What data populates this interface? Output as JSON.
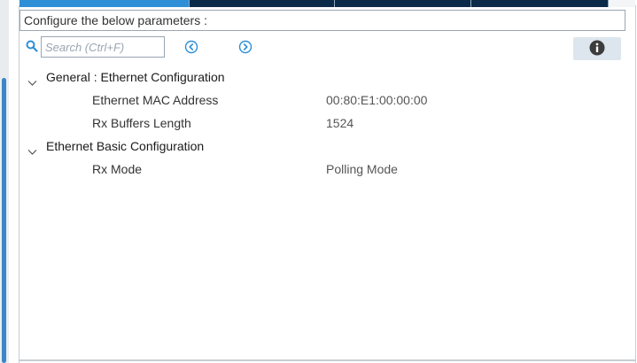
{
  "header": {
    "title": "Configure the below parameters :"
  },
  "search": {
    "placeholder": "Search (Ctrl+F)"
  },
  "icons": {
    "search": "search-icon",
    "prev": "circle-chevron-left-icon",
    "next": "circle-chevron-right-icon",
    "info": "info-icon",
    "expand": "chevron-down-icon"
  },
  "colors": {
    "accent": "#2e8fd6",
    "tab_bar": "#0b2a4a",
    "info_button_bg": "#dde6ee"
  },
  "tree": {
    "groups": [
      {
        "label": "General : Ethernet Configuration",
        "expanded": true,
        "params": [
          {
            "name": "Ethernet MAC Address",
            "value": "00:80:E1:00:00:00"
          },
          {
            "name": "Rx Buffers Length",
            "value": "1524"
          }
        ]
      },
      {
        "label": "Ethernet Basic Configuration",
        "expanded": true,
        "params": [
          {
            "name": "Rx Mode",
            "value": "Polling Mode"
          }
        ]
      }
    ]
  }
}
